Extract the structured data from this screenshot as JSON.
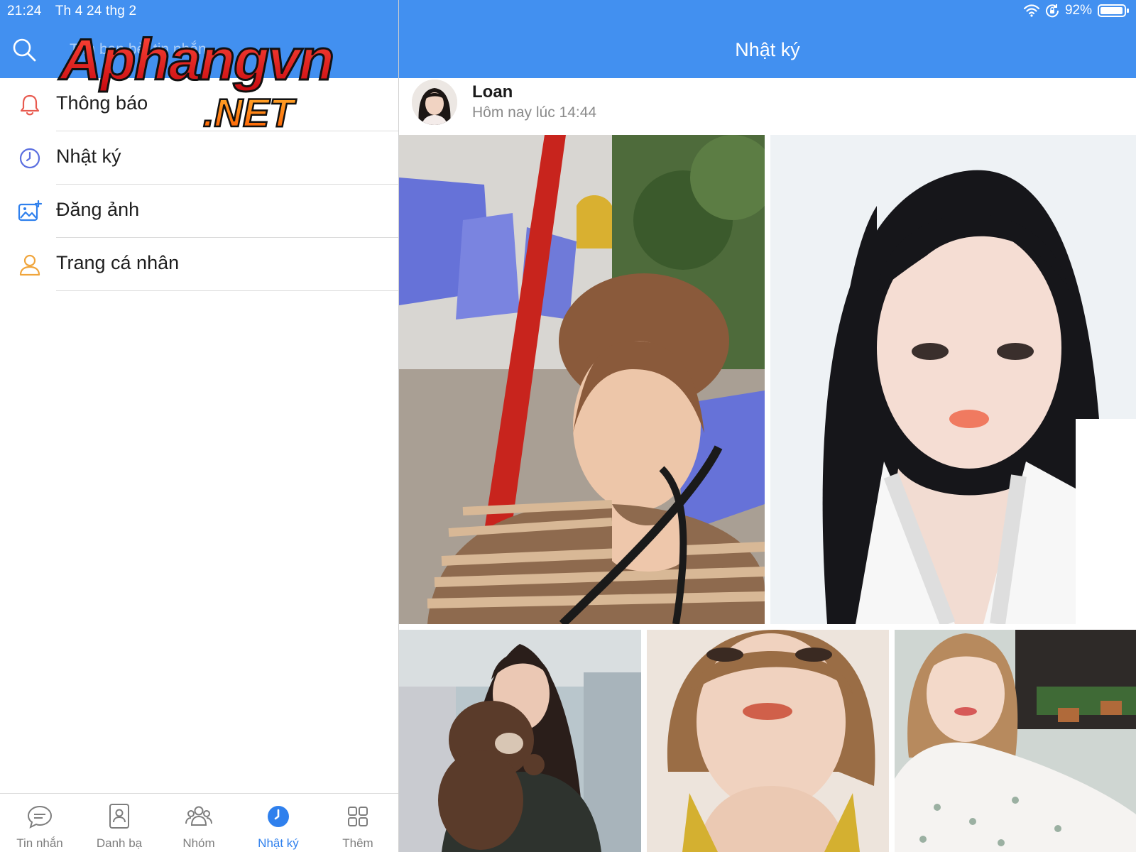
{
  "status_bar": {
    "time": "21:24",
    "date": "Th 4 24 thg 2",
    "battery": "92%",
    "battery_level": 0.92
  },
  "left_panel": {
    "search_placeholder": "Tìm bạn bè, tin nhắn...",
    "menu": [
      {
        "label": "Thông báo",
        "icon": "bell-icon",
        "icon_color": "#e85a4f"
      },
      {
        "label": "Nhật ký",
        "icon": "clock-icon",
        "icon_color": "#5b6fe0"
      },
      {
        "label": "Đăng ảnh",
        "icon": "add-photo-icon",
        "icon_color": "#2f80ed"
      },
      {
        "label": "Trang cá nhân",
        "icon": "person-icon",
        "icon_color": "#f0a53c"
      }
    ],
    "tabs": [
      {
        "label": "Tin nhắn",
        "icon": "chat-bubble-icon",
        "active": false
      },
      {
        "label": "Danh bạ",
        "icon": "contacts-icon",
        "active": false
      },
      {
        "label": "Nhóm",
        "icon": "group-icon",
        "active": false
      },
      {
        "label": "Nhật ký",
        "icon": "clock-filled-icon",
        "active": true
      },
      {
        "label": "Thêm",
        "icon": "grid-icon",
        "active": false
      }
    ]
  },
  "watermark": {
    "brand": "Aphangvn",
    "suffix": ".NET"
  },
  "right_panel": {
    "title": "Nhật ký",
    "post": {
      "author": "Loan",
      "time": "Hôm nay lúc 14:44",
      "photos": [
        {
          "name": "photo-selfie-striped-top"
        },
        {
          "name": "photo-portrait-white-lace"
        },
        {
          "name": "photo-girl-with-teddy-bear"
        },
        {
          "name": "photo-closeup-short-hair"
        },
        {
          "name": "photo-white-floral-dress"
        }
      ]
    }
  },
  "colors": {
    "header_blue": "#4290f0",
    "active_tab": "#2f80ed",
    "tab_inactive": "#7d7d7d"
  }
}
